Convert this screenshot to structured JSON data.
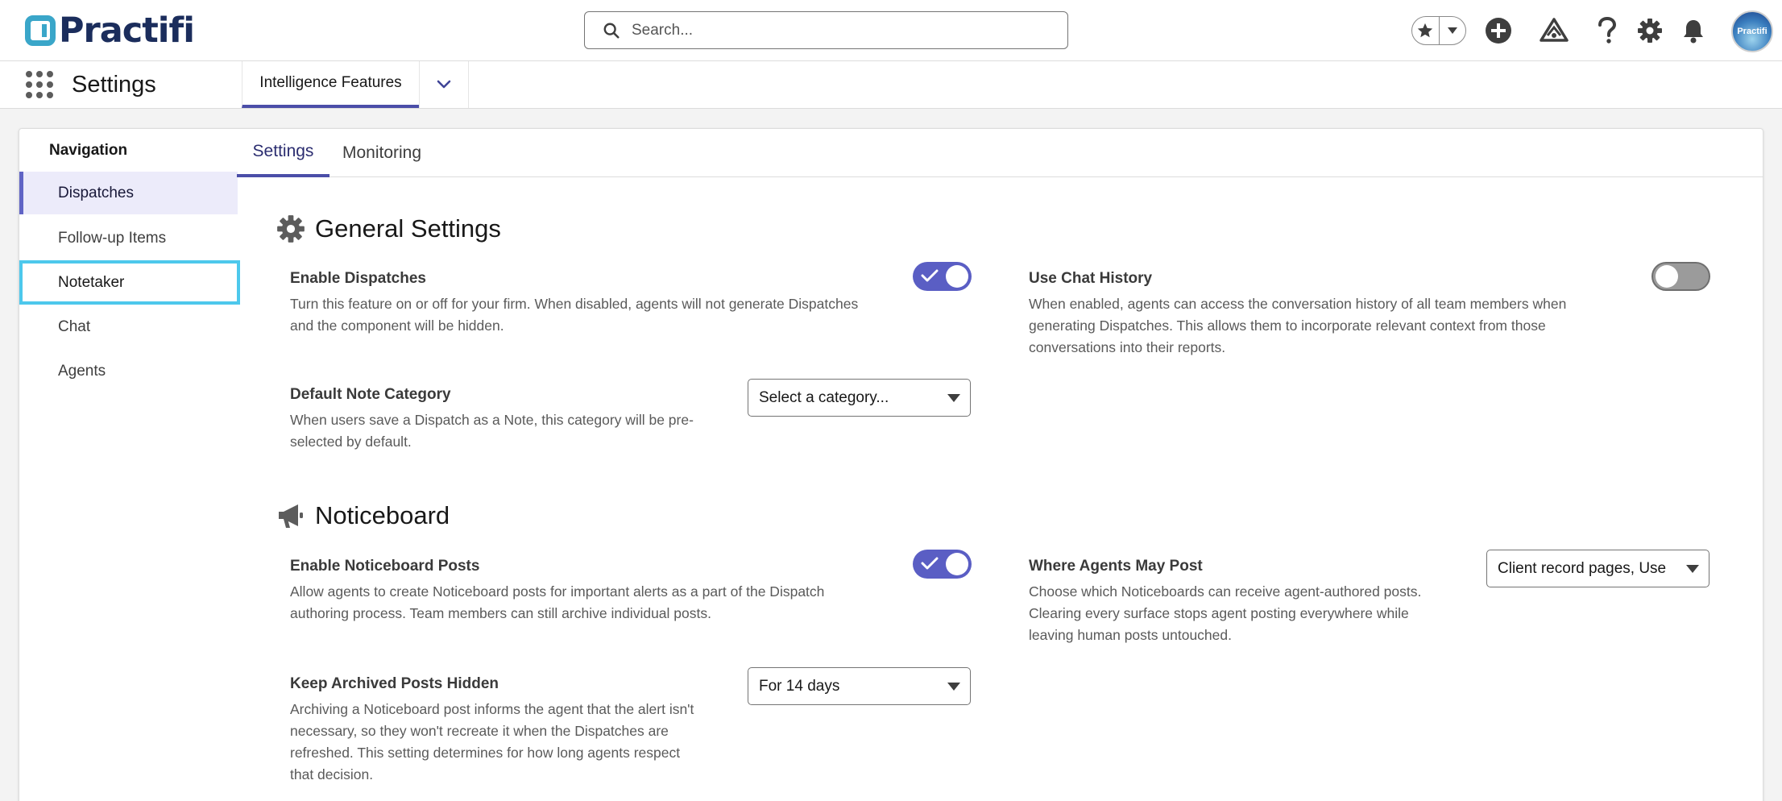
{
  "header": {
    "logo_text": "Practifi",
    "search_placeholder": "Search...",
    "avatar_text": "Practifi",
    "icons": [
      "favorites-star-icon",
      "favorites-dropdown-icon",
      "add-icon",
      "trailhead-icon",
      "help-icon",
      "setup-gear-icon",
      "notification-bell-icon"
    ]
  },
  "appbar": {
    "app_title": "Settings",
    "active_tab": "Intelligence Features"
  },
  "nav": {
    "title": "Navigation",
    "items": [
      {
        "label": "Dispatches",
        "state": "selected"
      },
      {
        "label": "Follow-up Items",
        "state": "default"
      },
      {
        "label": "Notetaker",
        "state": "focused"
      },
      {
        "label": "Chat",
        "state": "default"
      },
      {
        "label": "Agents",
        "state": "default"
      }
    ]
  },
  "subtabs": {
    "settings": "Settings",
    "monitoring": "Monitoring",
    "active": "Settings"
  },
  "general": {
    "title": "General Settings",
    "enable_dispatches": {
      "label": "Enable Dispatches",
      "line1": "Turn this feature on or off for your firm. When disabled, agents will not generate Dispatches",
      "line2": "and the component will be hidden.",
      "enabled": true
    },
    "use_chat_history": {
      "label": "Use Chat History",
      "line1": "When enabled, agents can access the conversation history of all team members when",
      "line2": "generating Dispatches. This allows them to incorporate relevant context from those",
      "line3": "conversations into their reports.",
      "enabled": false
    },
    "default_note_category": {
      "label": "Default Note Category",
      "line1": "When users save a Dispatch as a Note, this category will be pre-",
      "line2": "selected by default.",
      "value": "Select a category..."
    }
  },
  "noticeboard": {
    "title": "Noticeboard",
    "enable_posts": {
      "label": "Enable Noticeboard Posts",
      "line1": "Allow agents to create Noticeboard posts for important alerts as a part of the Dispatch",
      "line2": "authoring process. Team members can still archive individual posts.",
      "enabled": true
    },
    "where_agents_may_post": {
      "label": "Where Agents May Post",
      "line1": "Choose which Noticeboards can receive agent-authored posts.",
      "line2": "Clearing every surface stops agent posting everywhere while",
      "line3": "leaving human posts untouched.",
      "value": "Client record pages, Use"
    },
    "keep_archived_hidden": {
      "label": "Keep Archived Posts Hidden",
      "line1": "Archiving a Noticeboard post informs the agent that the alert isn't",
      "line2": "necessary, so they won't recreate it when the Dispatches are",
      "line3": "refreshed. This setting determines for how long agents respect",
      "line4": "that decision.",
      "value": "For 14 days"
    }
  },
  "colors": {
    "accent": "#5a5ec4",
    "focus_ring": "#4dc8ec",
    "logo_navy": "#1b2d5c",
    "logo_teal": "#3aa6c9"
  }
}
